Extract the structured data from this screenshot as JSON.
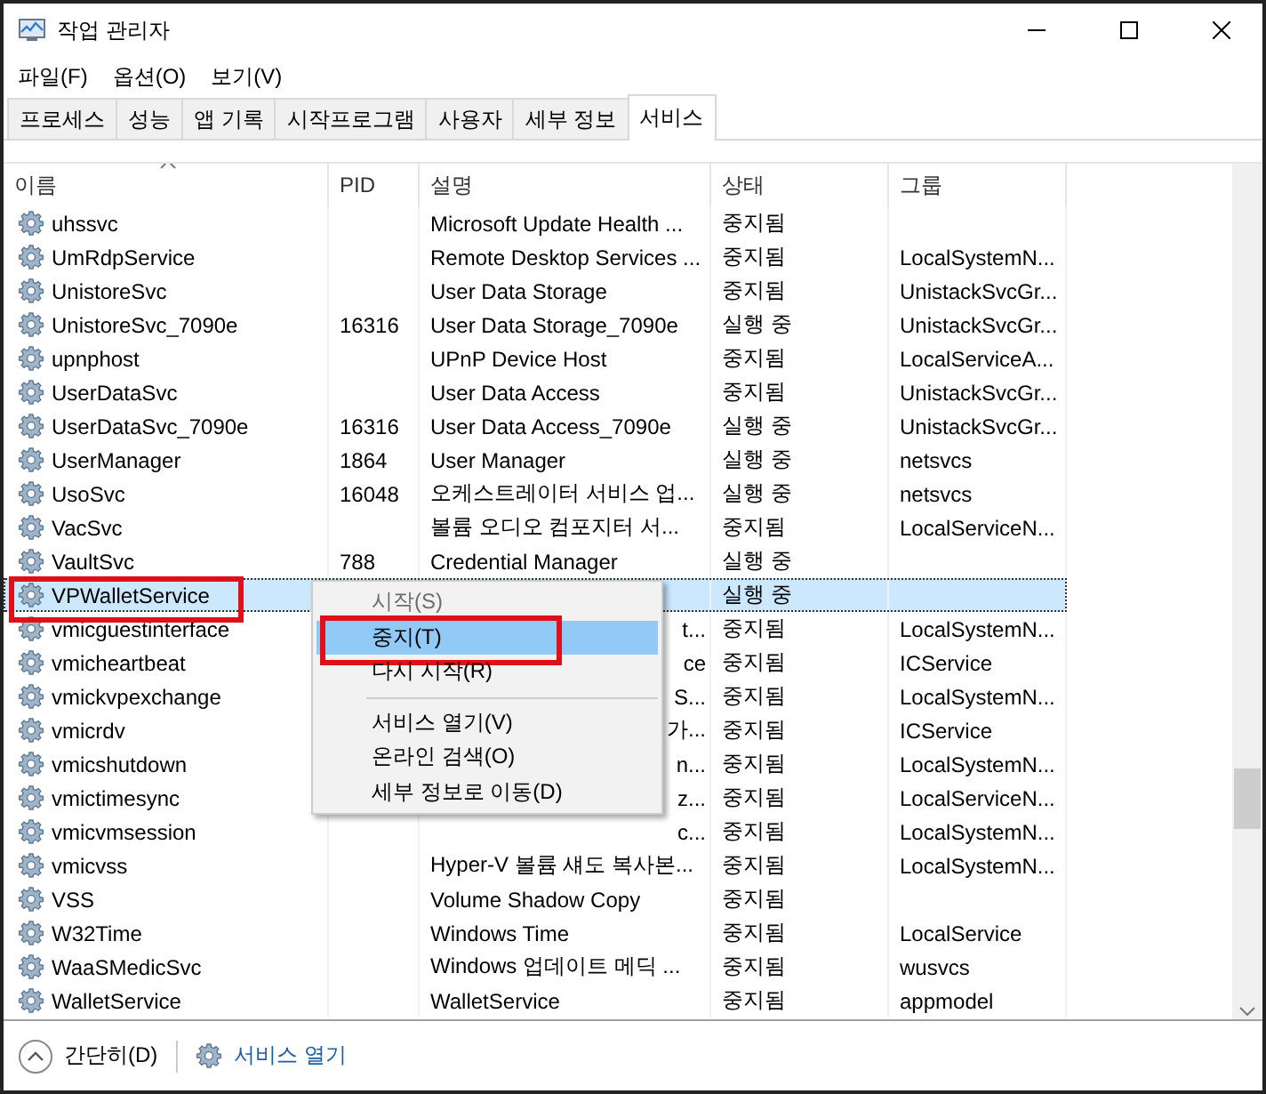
{
  "window": {
    "title": "작업 관리자"
  },
  "menu_bar": [
    "파일(F)",
    "옵션(O)",
    "보기(V)"
  ],
  "tabs": [
    {
      "label": "프로세스",
      "selected": false
    },
    {
      "label": "성능",
      "selected": false
    },
    {
      "label": "앱 기록",
      "selected": false
    },
    {
      "label": "시작프로그램",
      "selected": false
    },
    {
      "label": "사용자",
      "selected": false
    },
    {
      "label": "세부 정보",
      "selected": false
    },
    {
      "label": "서비스",
      "selected": true
    }
  ],
  "table": {
    "columns": [
      "이름",
      "PID",
      "설명",
      "상태",
      "그룹"
    ],
    "rows": [
      {
        "name": "uhssvc",
        "pid": "",
        "description": "Microsoft Update Health ...",
        "status": "중지됨",
        "group": "",
        "selected": false
      },
      {
        "name": "UmRdpService",
        "pid": "",
        "description": "Remote Desktop Services ...",
        "status": "중지됨",
        "group": "LocalSystemN...",
        "selected": false
      },
      {
        "name": "UnistoreSvc",
        "pid": "",
        "description": "User Data Storage",
        "status": "중지됨",
        "group": "UnistackSvcGr...",
        "selected": false
      },
      {
        "name": "UnistoreSvc_7090e",
        "pid": "16316",
        "description": "User Data Storage_7090e",
        "status": "실행 중",
        "group": "UnistackSvcGr...",
        "selected": false
      },
      {
        "name": "upnphost",
        "pid": "",
        "description": "UPnP Device Host",
        "status": "중지됨",
        "group": "LocalServiceA...",
        "selected": false
      },
      {
        "name": "UserDataSvc",
        "pid": "",
        "description": "User Data Access",
        "status": "중지됨",
        "group": "UnistackSvcGr...",
        "selected": false
      },
      {
        "name": "UserDataSvc_7090e",
        "pid": "16316",
        "description": "User Data Access_7090e",
        "status": "실행 중",
        "group": "UnistackSvcGr...",
        "selected": false
      },
      {
        "name": "UserManager",
        "pid": "1864",
        "description": "User Manager",
        "status": "실행 중",
        "group": "netsvcs",
        "selected": false
      },
      {
        "name": "UsoSvc",
        "pid": "16048",
        "description": "오케스트레이터 서비스 업...",
        "status": "실행 중",
        "group": "netsvcs",
        "selected": false
      },
      {
        "name": "VacSvc",
        "pid": "",
        "description": "볼륨 오디오 컴포지터 서...",
        "status": "중지됨",
        "group": "LocalServiceN...",
        "selected": false
      },
      {
        "name": "VaultSvc",
        "pid": "788",
        "description": "Credential Manager",
        "status": "실행 중",
        "group": "",
        "selected": false
      },
      {
        "name": "VPWalletService",
        "pid": "",
        "description": "",
        "status": "실행 중",
        "group": "",
        "selected": true,
        "annotated": true
      },
      {
        "name": "vmicguestinterface",
        "pid": "",
        "description_end": "t...",
        "status": "중지됨",
        "group": "LocalSystemN...",
        "selected": false
      },
      {
        "name": "vmicheartbeat",
        "pid": "",
        "description_end": "ce",
        "status": "중지됨",
        "group": "ICService",
        "selected": false
      },
      {
        "name": "vmickvpexchange",
        "pid": "",
        "description_end": "S...",
        "status": "중지됨",
        "group": "LocalSystemN...",
        "selected": false
      },
      {
        "name": "vmicrdv",
        "pid": "",
        "description_end": "가...",
        "status": "중지됨",
        "group": "ICService",
        "selected": false
      },
      {
        "name": "vmicshutdown",
        "pid": "",
        "description_end": "n...",
        "status": "중지됨",
        "group": "LocalSystemN...",
        "selected": false
      },
      {
        "name": "vmictimesync",
        "pid": "",
        "description_end": "z...",
        "status": "중지됨",
        "group": "LocalServiceN...",
        "selected": false
      },
      {
        "name": "vmicvmsession",
        "pid": "",
        "description_end": "c...",
        "status": "중지됨",
        "group": "LocalSystemN...",
        "selected": false
      },
      {
        "name": "vmicvss",
        "pid": "",
        "description": "Hyper-V 볼륨 섀도 복사본...",
        "status": "중지됨",
        "group": "LocalSystemN...",
        "selected": false
      },
      {
        "name": "VSS",
        "pid": "",
        "description": "Volume Shadow Copy",
        "status": "중지됨",
        "group": "",
        "selected": false
      },
      {
        "name": "W32Time",
        "pid": "",
        "description": "Windows Time",
        "status": "중지됨",
        "group": "LocalService",
        "selected": false
      },
      {
        "name": "WaaSMedicSvc",
        "pid": "",
        "description": "Windows 업데이트 메딕 ...",
        "status": "중지됨",
        "group": "wusvcs",
        "selected": false
      },
      {
        "name": "WalletService",
        "pid": "",
        "description": "WalletService",
        "status": "중지됨",
        "group": "appmodel",
        "selected": false
      }
    ]
  },
  "context_menu": {
    "items": [
      {
        "kind": "item",
        "label": "시작(S)",
        "disabled": true,
        "selected": false
      },
      {
        "kind": "item",
        "label": "중지(T)",
        "disabled": false,
        "selected": true,
        "annotated": true
      },
      {
        "kind": "item",
        "label": "다시 시작(R)",
        "disabled": false,
        "selected": false
      },
      {
        "kind": "separator"
      },
      {
        "kind": "item",
        "label": "서비스 열기(V)",
        "disabled": false,
        "selected": false
      },
      {
        "kind": "item",
        "label": "온라인 검색(O)",
        "disabled": false,
        "selected": false
      },
      {
        "kind": "item",
        "label": "세부 정보로 이동(D)",
        "disabled": false,
        "selected": false
      }
    ]
  },
  "footer": {
    "collapse_label": "간단히(D)",
    "link": "서비스 열기"
  }
}
